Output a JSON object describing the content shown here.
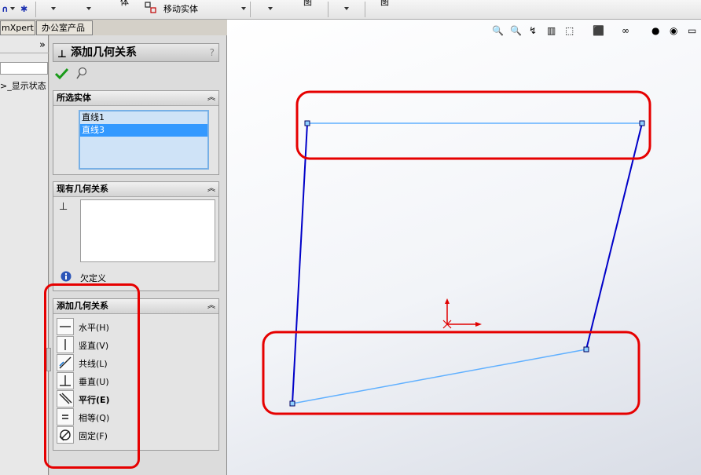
{
  "toolbar": {
    "star": "✱",
    "truncated1": "体",
    "move_label": "移动实体",
    "truncated2": "图",
    "truncated3": "图"
  },
  "tabs": [
    {
      "label": "mXpert"
    },
    {
      "label": "办公室产品"
    }
  ],
  "tree": {
    "collapse": "»",
    "display_state": ">_显示状态"
  },
  "property_manager": {
    "title": "添加几何关系",
    "help": "?",
    "selected_entities": {
      "header": "所选实体",
      "items": [
        "直线1",
        "直线3"
      ],
      "active_index": 1
    },
    "existing_relations": {
      "header": "现有几何关系",
      "status": "欠定义"
    },
    "add_relations": {
      "header": "添加几何关系",
      "items": [
        {
          "label": "水平(H)",
          "icon": "horizontal-icon"
        },
        {
          "label": "竖直(V)",
          "icon": "vertical-icon"
        },
        {
          "label": "共线(L)",
          "icon": "collinear-icon"
        },
        {
          "label": "垂直(U)",
          "icon": "perpendicular-icon"
        },
        {
          "label": "平行(E)",
          "icon": "parallel-icon"
        },
        {
          "label": "相等(Q)",
          "icon": "equal-icon"
        },
        {
          "label": "固定(F)",
          "icon": "fix-icon"
        }
      ]
    }
  },
  "colors": {
    "sketch_line": "#0000c8",
    "selected_line": "#60b0ff",
    "highlight_red": "#e60000",
    "origin": "#e00000"
  }
}
